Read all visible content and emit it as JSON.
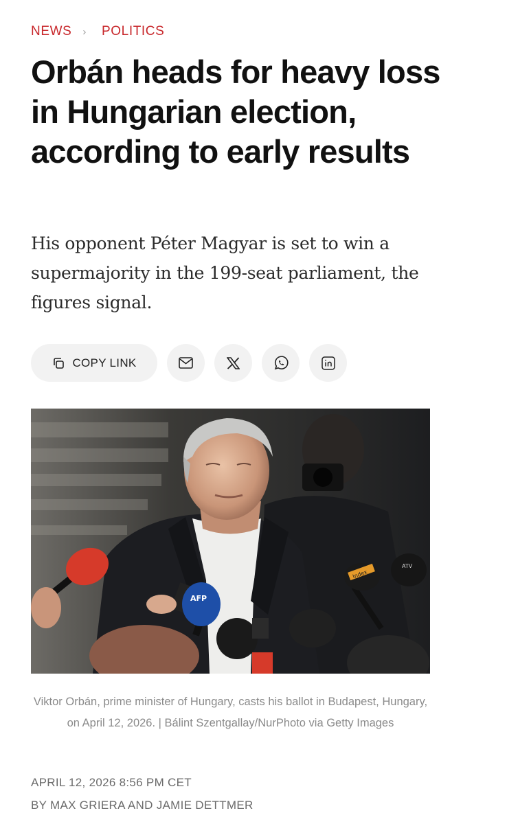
{
  "breadcrumb": {
    "section": "NEWS",
    "separator": "›",
    "subsection": "POLITICS"
  },
  "article": {
    "headline": "Orbán heads for heavy loss in Hungarian election, according to early results",
    "dek": "His opponent Péter Magyar is set to win a supermajority in the 199-seat parliament, the figures signal.",
    "caption": "Viktor Orbán, prime minister of Hungary, casts his ballot in Budapest, Hungary, on April 12, 2026. | Bálint Szentgallay/NurPhoto via Getty Images",
    "date": "APRIL 12, 2026 8:56 PM CET",
    "byline": "BY MAX GRIERA AND JAMIE DETTMER"
  },
  "share": {
    "copy_link_label": "COPY LINK",
    "icons": [
      "copy-icon",
      "mail-icon",
      "x-icon",
      "whatsapp-icon",
      "linkedin-icon"
    ]
  },
  "photo": {
    "mic_label_1": "AFP",
    "mic_label_2": "Index",
    "mic_label_3": "ATV"
  },
  "colors": {
    "accent": "#c8272b",
    "text": "#111111",
    "muted": "#8a8a8a",
    "button_bg": "#f2f2f2"
  }
}
